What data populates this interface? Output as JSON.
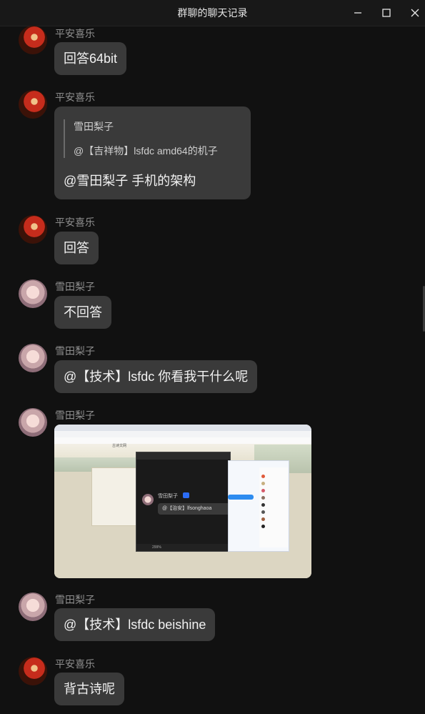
{
  "window": {
    "title": "群聊的聊天记录",
    "minimize_icon": "minimize-icon",
    "maximize_icon": "maximize-icon",
    "close_icon": "close-icon"
  },
  "messages": [
    {
      "nickname": "平安喜乐",
      "avatar": "red-character-avatar",
      "text": "回答64bit"
    },
    {
      "nickname": "平安喜乐",
      "avatar": "red-character-avatar",
      "quote": {
        "name": "雪田梨子",
        "text": "@【吉祥物】lsfdc amd64的机子"
      },
      "text": "@雪田梨子 手机的架构"
    },
    {
      "nickname": "平安喜乐",
      "avatar": "red-character-avatar",
      "text": "回答"
    },
    {
      "nickname": "雪田梨子",
      "avatar": "pink-anime-avatar",
      "text": "不回答"
    },
    {
      "nickname": "雪田梨子",
      "avatar": "pink-anime-avatar",
      "text": "@【技术】lsfdc 你看我干什么呢"
    },
    {
      "nickname": "雪田梨子",
      "avatar": "pink-anime-avatar",
      "image": {
        "site_name": "古诗文网",
        "inner_nickname": "雪田梨子",
        "inner_badge": "A",
        "inner_message": "@【治安】lfsonghaoa",
        "zoom": "299%"
      }
    },
    {
      "nickname": "雪田梨子",
      "avatar": "pink-anime-avatar",
      "text": "@【技术】lsfdc beishine"
    },
    {
      "nickname": "平安喜乐",
      "avatar": "red-character-avatar",
      "text": "背古诗呢"
    }
  ]
}
